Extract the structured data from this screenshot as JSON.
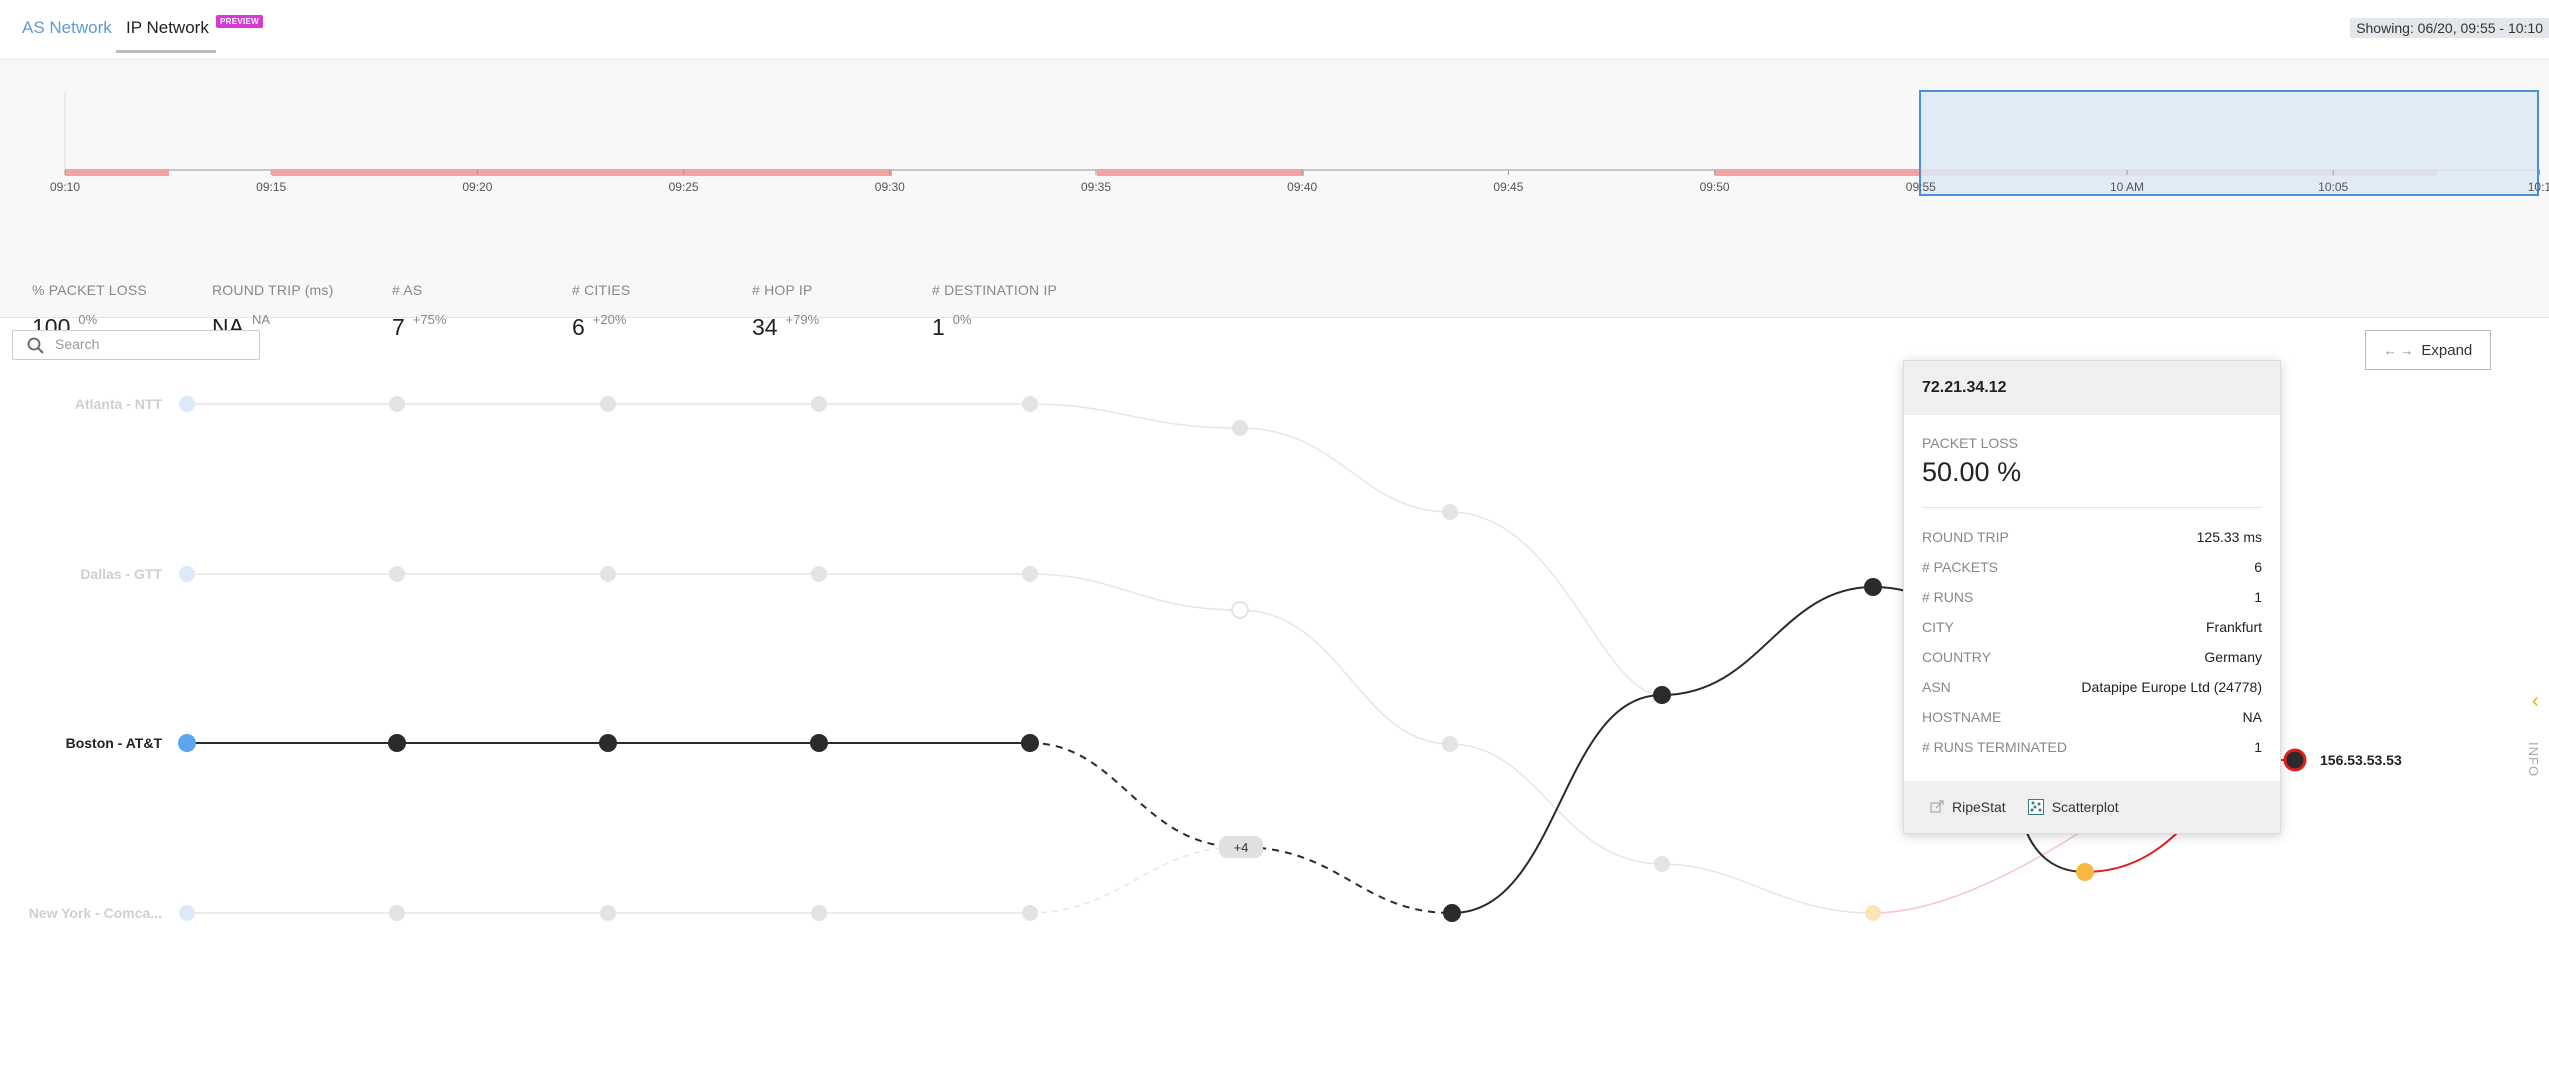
{
  "tabs": {
    "as_network": "AS Network",
    "ip_network": "IP Network",
    "preview_badge": "PREVIEW"
  },
  "showing": "Showing: 06/20, 09:55 - 10:10",
  "timeline": {
    "ticks": [
      "09:10",
      "09:15",
      "09:20",
      "09:25",
      "09:30",
      "09:35",
      "09:40",
      "09:45",
      "09:50",
      "09:55",
      "10 AM",
      "10:05",
      "10:1"
    ]
  },
  "stats": [
    {
      "label": "% PACKET LOSS",
      "value": "100",
      "delta": "0%"
    },
    {
      "label": "ROUND TRIP (ms)",
      "value": "NA",
      "delta": "NA"
    },
    {
      "label": "# AS",
      "value": "7",
      "delta": "+75%"
    },
    {
      "label": "# CITIES",
      "value": "6",
      "delta": "+20%"
    },
    {
      "label": "# HOP IP",
      "value": "34",
      "delta": "+79%"
    },
    {
      "label": "# DESTINATION IP",
      "value": "1",
      "delta": "0%"
    }
  ],
  "search": {
    "placeholder": "Search"
  },
  "expand_label": "Expand",
  "side_tab": {
    "label": "INFO"
  },
  "network": {
    "sources": [
      "Atlanta - NTT",
      "Dallas - GTT",
      "Boston - AT&T",
      "New York - Comca..."
    ],
    "group_badge": "+4",
    "destination_ip": "156.53.53.53"
  },
  "tooltip": {
    "ip": "72.21.34.12",
    "packet_loss_label": "PACKET LOSS",
    "packet_loss_value": "50.00 %",
    "rows": [
      {
        "key": "ROUND TRIP",
        "value": "125.33 ms"
      },
      {
        "key": "# PACKETS",
        "value": "6"
      },
      {
        "key": "# RUNS",
        "value": "1"
      },
      {
        "key": "CITY",
        "value": "Frankfurt"
      },
      {
        "key": "COUNTRY",
        "value": "Germany"
      },
      {
        "key": "ASN",
        "value": "Datapipe Europe Ltd (24778)"
      },
      {
        "key": "HOSTNAME",
        "value": "NA"
      },
      {
        "key": "# RUNS TERMINATED",
        "value": "1"
      }
    ],
    "links": {
      "ripestat": "RipeStat",
      "scatterplot": "Scatterplot"
    }
  },
  "colors": {
    "accent": "#5b9bd5",
    "loss": "#f2a3a3",
    "selection": "#dde9f6",
    "selection_border": "#4a90d9",
    "node": "#2b2b2b",
    "warn": "#f7b740",
    "critical": "#e02020",
    "badge": "#d63ad6"
  }
}
